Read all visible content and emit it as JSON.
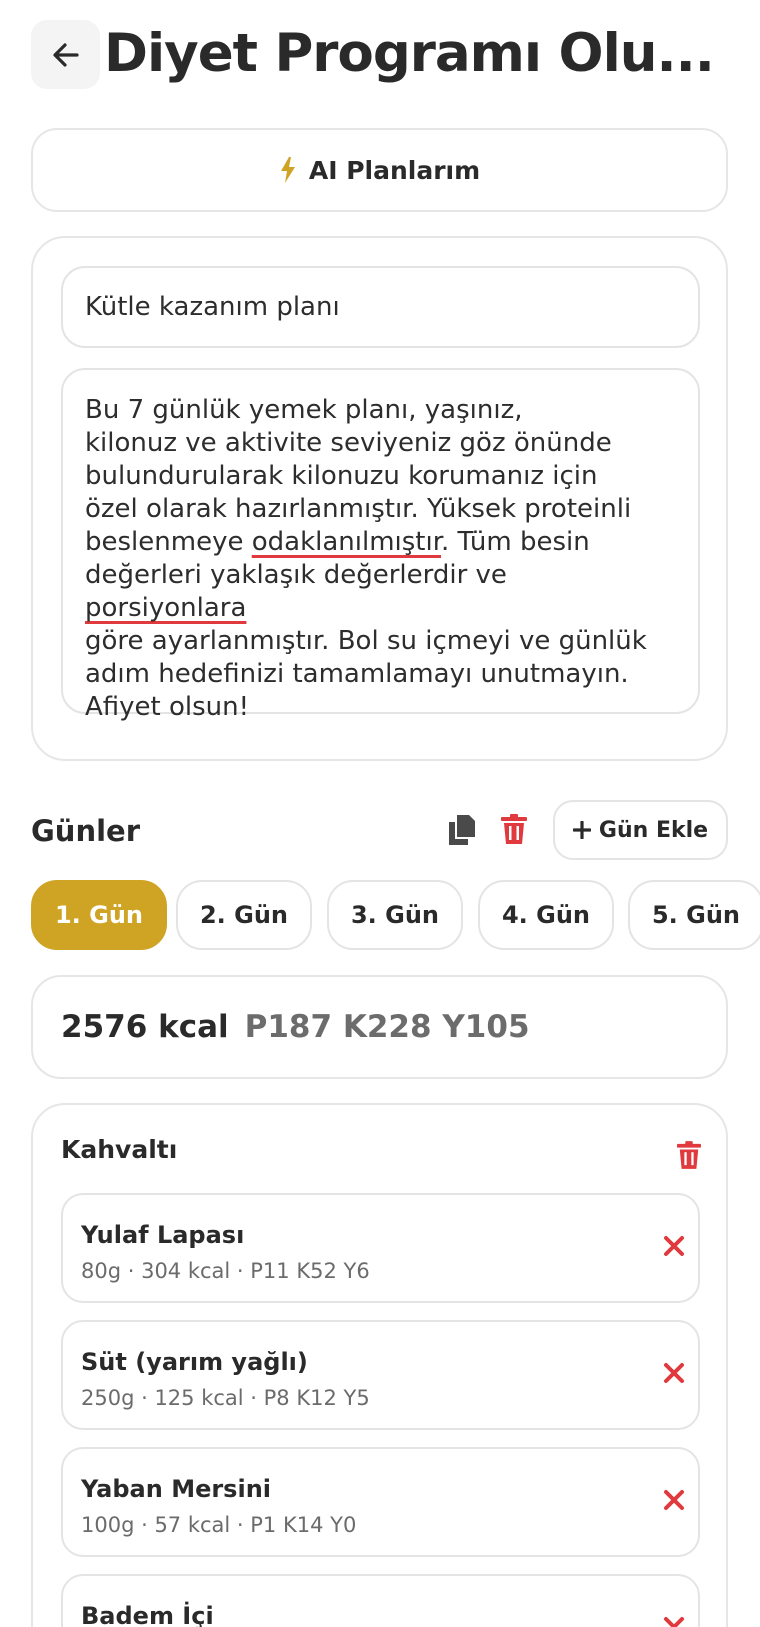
{
  "header": {
    "title": "Diyet Programı Olu..."
  },
  "ai_button": {
    "label": "AI Planlarım"
  },
  "plan": {
    "name": "Kütle kazanım planı",
    "description_parts": [
      "Bu 7 günlük yemek planı, yaşınız,",
      "kilonuz ve aktivite seviyeniz göz önünde",
      "bulundurularak kilonuzu korumanız için",
      "özel olarak hazırlanmıştır. Yüksek proteinli",
      "beslenmeye ",
      "odaklanılmıştır",
      ". Tüm besin",
      "değerleri yaklaşık değerlerdir ve ",
      "porsiyonlara",
      "göre ayarlanmıştır. Bol su içmeyi ve günlük",
      "adım hedefinizi tamamlamayı unutmayın.",
      "Afiyet olsun!"
    ]
  },
  "days": {
    "title": "Günler",
    "add_label": "Gün Ekle",
    "tabs": [
      "1. Gün",
      "2. Gün",
      "3. Gün",
      "4. Gün",
      "5. Gün"
    ],
    "active_index": 0
  },
  "totals": {
    "kcal": "2576 kcal",
    "macros": "P187 K228 Y105"
  },
  "meal": {
    "title": "Kahvaltı",
    "items": [
      {
        "name": "Yulaf Lapası",
        "meta": "80g · 304 kcal · P11 K52 Y6"
      },
      {
        "name": "Süt (yarım yağlı)",
        "meta": "250g · 125 kcal · P8 K12 Y5"
      },
      {
        "name": "Yaban Mersini",
        "meta": "100g · 57 kcal · P1 K14 Y0"
      },
      {
        "name": "Badem İçi",
        "meta": ""
      }
    ]
  },
  "colors": {
    "accent": "#cfa425",
    "danger": "#e0393e",
    "border": "#e6e6e6"
  },
  "icons": {
    "back": "arrow-left-icon",
    "ai": "lightning-icon",
    "copy": "copy-icon",
    "delete": "trash-icon",
    "add": "plus-icon",
    "remove": "close-icon"
  }
}
